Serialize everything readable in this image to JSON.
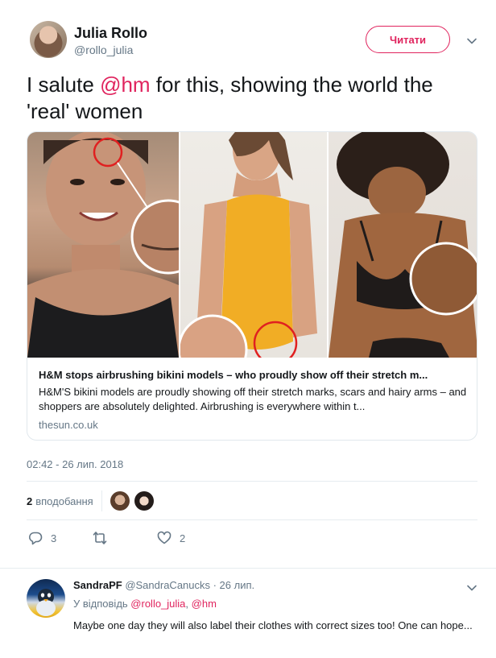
{
  "tweet": {
    "author_name": "Julia Rollo",
    "author_handle": "@rollo_julia",
    "follow_label": "Читати",
    "text_before": "I salute ",
    "text_mention": "@hm",
    "text_after": " for this, showing the world the 'real' women",
    "timestamp": "02:42 - 26 лип. 2018",
    "likes_count": "2",
    "likes_label": "вподобання",
    "reply_count": "3",
    "retweet_count": "",
    "like_count": "2",
    "icons": {
      "menu": "chevron-down-icon",
      "reply": "reply-icon",
      "retweet": "retweet-icon",
      "like": "heart-icon"
    }
  },
  "card": {
    "title": "H&M stops airbrushing bikini models – who proudly show off their stretch m...",
    "description": "H&M'S bikini models are proudly showing off their stretch marks, scars and hairy arms – and shoppers are absolutely delighted. Airbrushing is everywhere within t...",
    "domain": "thesun.co.uk"
  },
  "reply": {
    "name": "SandraPF",
    "handle_time": "@SandraCanucks · 26 лип.",
    "reply_prefix": "У відповідь ",
    "mention1": "@rollo_julia",
    "separator": ", ",
    "mention2": "@hm",
    "text": "Maybe one day they will also label their clothes with correct sizes too! One can hope..."
  },
  "colors": {
    "accent": "#e0245e",
    "muted": "#657786",
    "text": "#14171a",
    "border": "#e1e8ed"
  }
}
